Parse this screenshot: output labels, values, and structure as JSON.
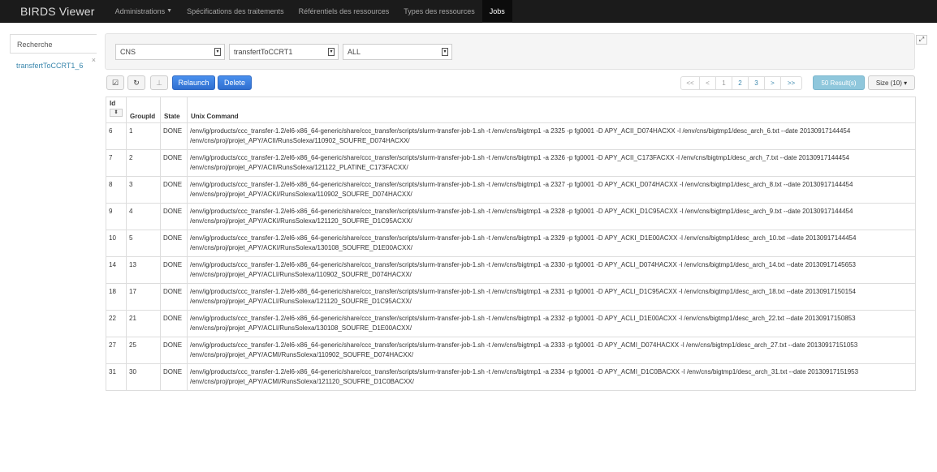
{
  "navbar": {
    "brand": "BIRDS Viewer",
    "items": [
      {
        "label": "Administrations",
        "has_caret": true
      },
      {
        "label": "Spécifications des traitements"
      },
      {
        "label": "Référentiels des ressources"
      },
      {
        "label": "Types des ressources"
      },
      {
        "label": "Jobs",
        "active": true
      }
    ]
  },
  "left_tabs": {
    "search_label": "Recherche",
    "job_tab_label": "transfertToCCRT1_6",
    "close_symbol": "×"
  },
  "filters": {
    "select1": "CNS",
    "select2": "transfertToCCRT1",
    "select3": "ALL"
  },
  "toolbar": {
    "check_icon": "☑",
    "refresh_icon": "↻",
    "pin_icon": "⊥",
    "relaunch_label": "Relaunch",
    "delete_label": "Delete"
  },
  "pagination": {
    "first": "<<",
    "prev": "<",
    "pages": [
      "1",
      "2",
      "3"
    ],
    "next": ">",
    "last": ">>"
  },
  "results_label": "50 Result(s)",
  "size_label": "Size (10) ▾",
  "table": {
    "headers": {
      "id": "Id",
      "groupid": "GroupId",
      "state": "State",
      "command": "Unix Command"
    },
    "rows": [
      {
        "id": "6",
        "group": "1",
        "state": "DONE",
        "cmd": "/env/ig/products/ccc_transfer-1.2/el6-x86_64-generic/share/ccc_transfer/scripts/slurm-transfer-job-1.sh -t /env/cns/bigtmp1 -a 2325 -p fg0001 -D APY_ACII_D074HACXX -l /env/cns/bigtmp1/desc_arch_6.txt --date 20130917144454 /env/cns/proj/projet_APY/ACII/RunsSolexa/110902_SOUFRE_D074HACXX/"
      },
      {
        "id": "7",
        "group": "2",
        "state": "DONE",
        "cmd": "/env/ig/products/ccc_transfer-1.2/el6-x86_64-generic/share/ccc_transfer/scripts/slurm-transfer-job-1.sh -t /env/cns/bigtmp1 -a 2326 -p fg0001 -D APY_ACII_C173FACXX -l /env/cns/bigtmp1/desc_arch_7.txt --date 20130917144454 /env/cns/proj/projet_APY/ACII/RunsSolexa/121122_PLATINE_C173FACXX/"
      },
      {
        "id": "8",
        "group": "3",
        "state": "DONE",
        "cmd": "/env/ig/products/ccc_transfer-1.2/el6-x86_64-generic/share/ccc_transfer/scripts/slurm-transfer-job-1.sh -t /env/cns/bigtmp1 -a 2327 -p fg0001 -D APY_ACKI_D074HACXX -l /env/cns/bigtmp1/desc_arch_8.txt --date 20130917144454 /env/cns/proj/projet_APY/ACKI/RunsSolexa/110902_SOUFRE_D074HACXX/"
      },
      {
        "id": "9",
        "group": "4",
        "state": "DONE",
        "cmd": "/env/ig/products/ccc_transfer-1.2/el6-x86_64-generic/share/ccc_transfer/scripts/slurm-transfer-job-1.sh -t /env/cns/bigtmp1 -a 2328 -p fg0001 -D APY_ACKI_D1C95ACXX -l /env/cns/bigtmp1/desc_arch_9.txt --date 20130917144454 /env/cns/proj/projet_APY/ACKI/RunsSolexa/121120_SOUFRE_D1C95ACXX/"
      },
      {
        "id": "10",
        "group": "5",
        "state": "DONE",
        "cmd": "/env/ig/products/ccc_transfer-1.2/el6-x86_64-generic/share/ccc_transfer/scripts/slurm-transfer-job-1.sh -t /env/cns/bigtmp1 -a 2329 -p fg0001 -D APY_ACKI_D1E00ACXX -l /env/cns/bigtmp1/desc_arch_10.txt --date 20130917144454 /env/cns/proj/projet_APY/ACKI/RunsSolexa/130108_SOUFRE_D1E00ACXX/"
      },
      {
        "id": "14",
        "group": "13",
        "state": "DONE",
        "cmd": "/env/ig/products/ccc_transfer-1.2/el6-x86_64-generic/share/ccc_transfer/scripts/slurm-transfer-job-1.sh -t /env/cns/bigtmp1 -a 2330 -p fg0001 -D APY_ACLI_D074HACXX -l /env/cns/bigtmp1/desc_arch_14.txt --date 20130917145653 /env/cns/proj/projet_APY/ACLI/RunsSolexa/110902_SOUFRE_D074HACXX/"
      },
      {
        "id": "18",
        "group": "17",
        "state": "DONE",
        "cmd": "/env/ig/products/ccc_transfer-1.2/el6-x86_64-generic/share/ccc_transfer/scripts/slurm-transfer-job-1.sh -t /env/cns/bigtmp1 -a 2331 -p fg0001 -D APY_ACLI_D1C95ACXX -l /env/cns/bigtmp1/desc_arch_18.txt --date 20130917150154 /env/cns/proj/projet_APY/ACLI/RunsSolexa/121120_SOUFRE_D1C95ACXX/"
      },
      {
        "id": "22",
        "group": "21",
        "state": "DONE",
        "cmd": "/env/ig/products/ccc_transfer-1.2/el6-x86_64-generic/share/ccc_transfer/scripts/slurm-transfer-job-1.sh -t /env/cns/bigtmp1 -a 2332 -p fg0001 -D APY_ACLI_D1E00ACXX -l /env/cns/bigtmp1/desc_arch_22.txt --date 20130917150853 /env/cns/proj/projet_APY/ACLI/RunsSolexa/130108_SOUFRE_D1E00ACXX/"
      },
      {
        "id": "27",
        "group": "25",
        "state": "DONE",
        "cmd": "/env/ig/products/ccc_transfer-1.2/el6-x86_64-generic/share/ccc_transfer/scripts/slurm-transfer-job-1.sh -t /env/cns/bigtmp1 -a 2333 -p fg0001 -D APY_ACMI_D074HACXX -l /env/cns/bigtmp1/desc_arch_27.txt --date 20130917151053 /env/cns/proj/projet_APY/ACMI/RunsSolexa/110902_SOUFRE_D074HACXX/"
      },
      {
        "id": "31",
        "group": "30",
        "state": "DONE",
        "cmd": "/env/ig/products/ccc_transfer-1.2/el6-x86_64-generic/share/ccc_transfer/scripts/slurm-transfer-job-1.sh -t /env/cns/bigtmp1 -a 2334 -p fg0001 -D APY_ACMI_D1C0BACXX -l /env/cns/bigtmp1/desc_arch_31.txt --date 20130917151953 /env/cns/proj/projet_APY/ACMI/RunsSolexa/121120_SOUFRE_D1C0BACXX/"
      }
    ]
  }
}
